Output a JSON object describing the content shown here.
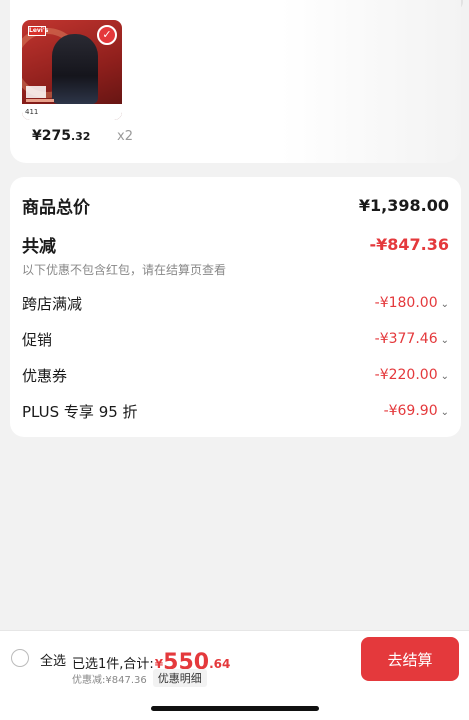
{
  "product": {
    "thumb_text": "411",
    "brand_mark": "Levi's",
    "price_int": "¥275",
    "price_dec": ".32",
    "quantity": "x2"
  },
  "summary": {
    "total_label": "商品总价",
    "total_value": "¥1,398.00",
    "reduce_label": "共减",
    "reduce_value": "-¥847.36",
    "note": "以下优惠不包含红包，请在结算页查看",
    "items": [
      {
        "label": "跨店满减",
        "value": "-¥180.00"
      },
      {
        "label": "促销",
        "value": "-¥377.46"
      },
      {
        "label": "优惠券",
        "value": "-¥220.00"
      },
      {
        "label": "PLUS 专享 95 折",
        "value": "-¥69.90"
      }
    ]
  },
  "bottom": {
    "select_all": "全选",
    "selected_text": "已选1件,合计:",
    "currency": "¥",
    "amount_int": "550",
    "amount_dec": ".64",
    "discount_text": "优惠减:¥847.36",
    "discount_detail": "优惠明细",
    "checkout": "去结算"
  },
  "colors": {
    "accent": "#e4393c",
    "background": "#f2f2f2",
    "card": "#ffffff"
  },
  "icons": {
    "chevron": "chevron-down-icon",
    "check": "check-icon",
    "radio": "radio-unchecked-icon"
  }
}
